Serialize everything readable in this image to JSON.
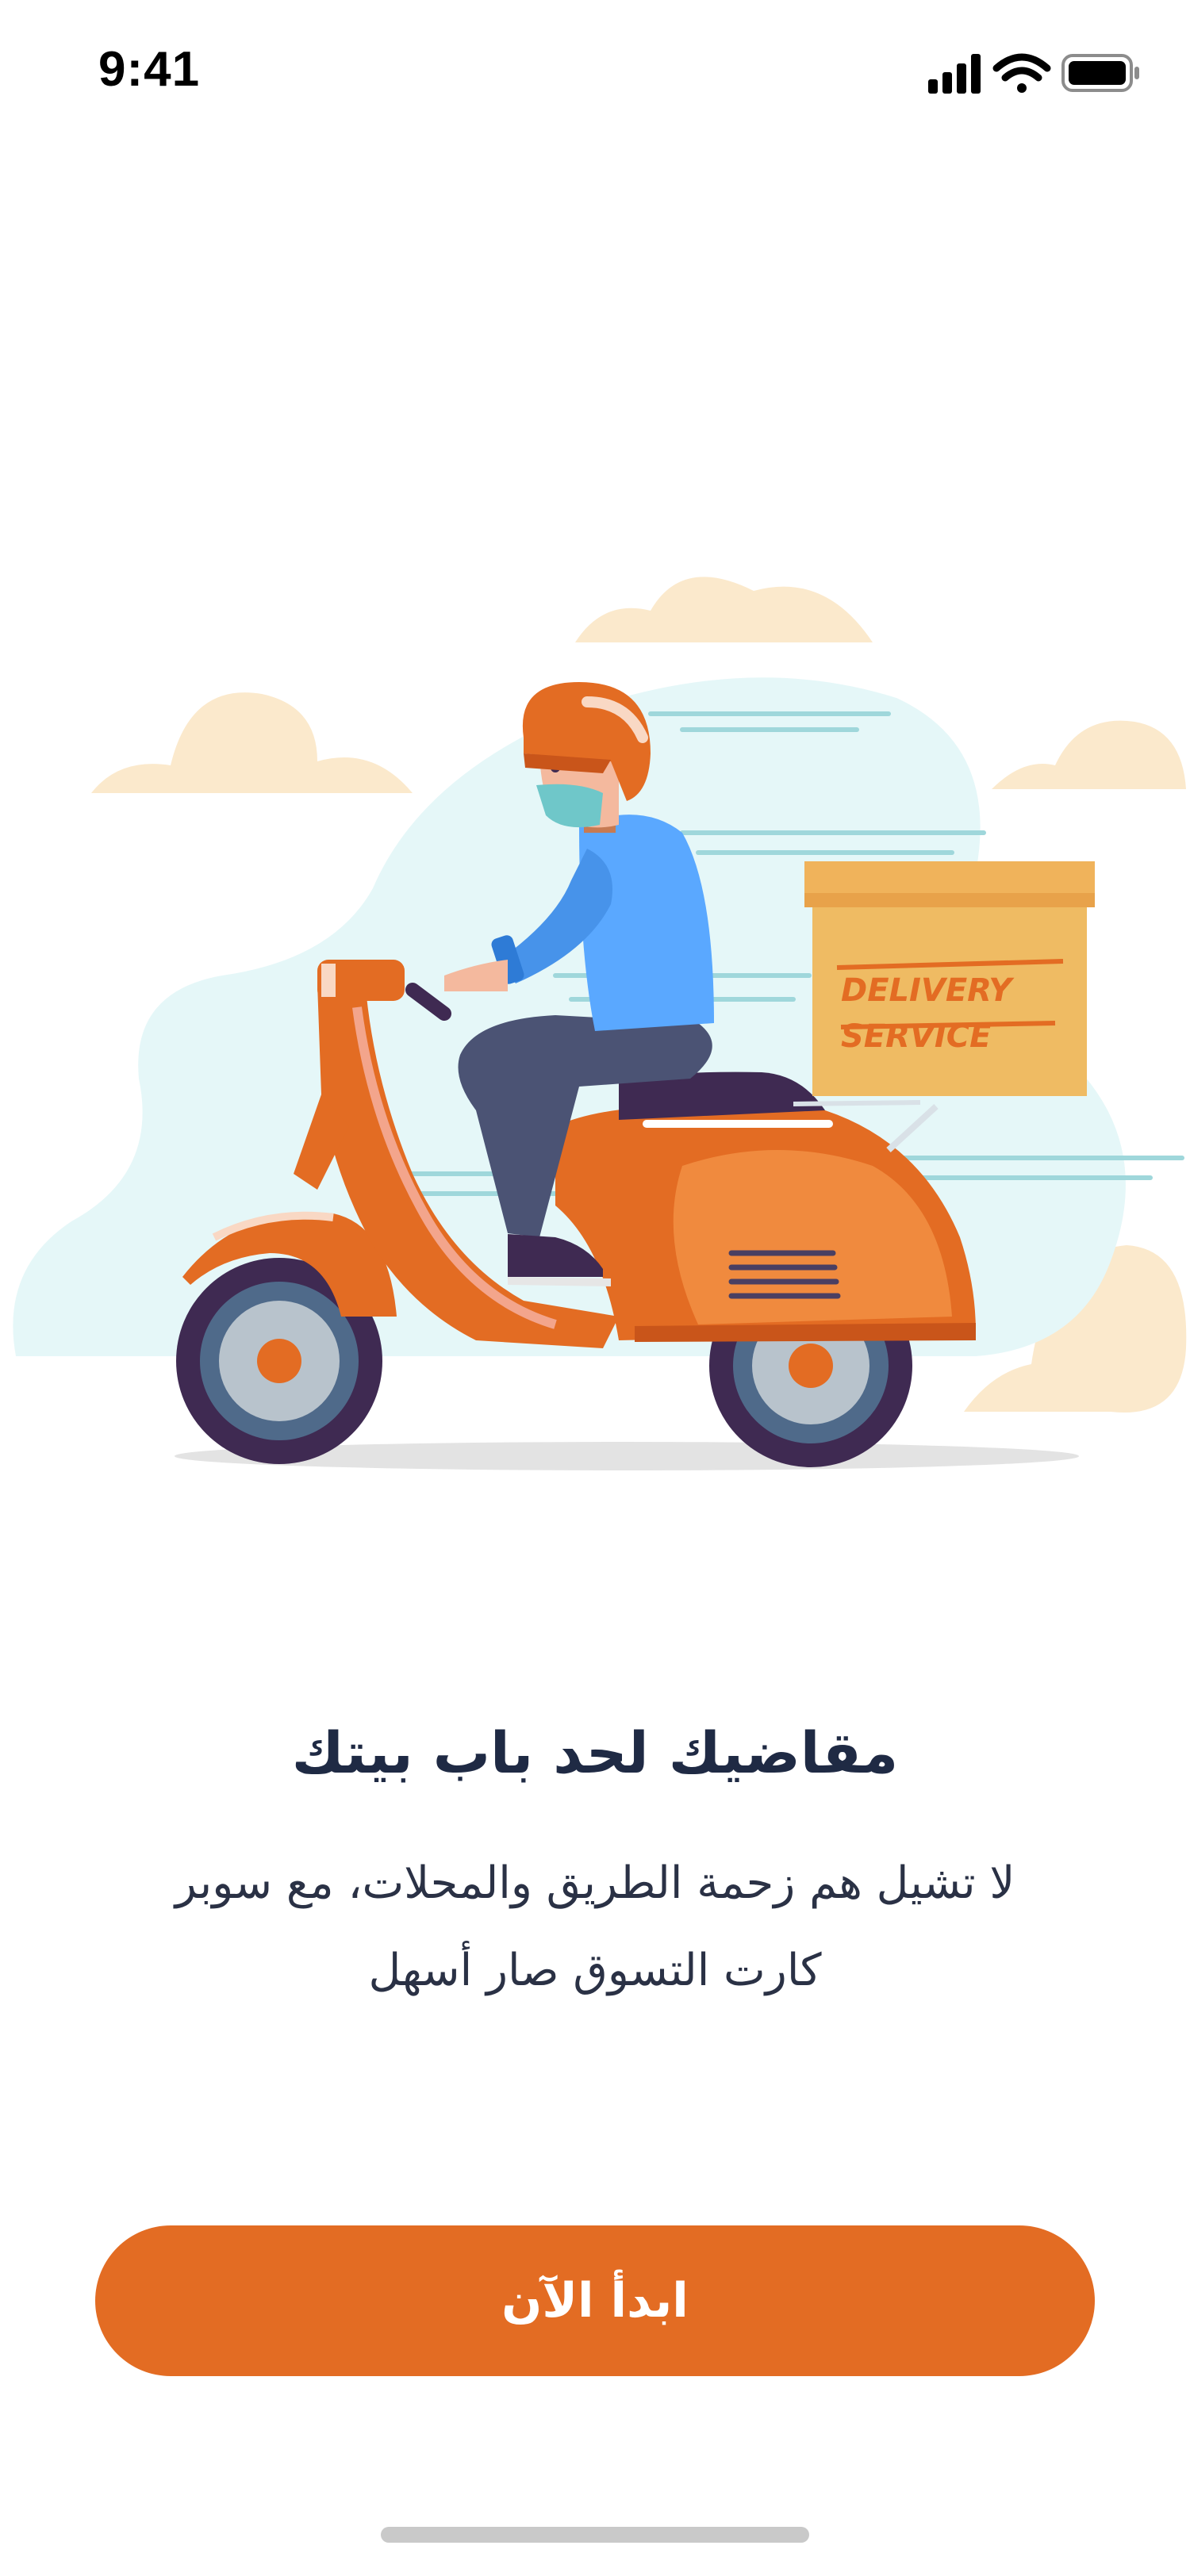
{
  "status_bar": {
    "time": "9:41",
    "icons": [
      "cellular-signal-icon",
      "wifi-icon",
      "battery-icon"
    ]
  },
  "illustration": {
    "box_text_line1": "DELIVERY",
    "box_text_line2": "SERVICE",
    "icon": "delivery-scooter-illustration"
  },
  "content": {
    "title": "مقاضيك لحد باب بيتك",
    "description_line1": "لا تشيل هم زحمة الطريق والمحلات، مع سوبر",
    "description_line2": "كارت التسوق صار أسهل"
  },
  "cta": {
    "label": "ابدأ الآن"
  },
  "colors": {
    "accent": "#e36c23",
    "title": "#1f2a44",
    "text": "#2a3145",
    "cloud": "#fbe9cc",
    "sky": "#e5f7f8",
    "box": "#efbb63",
    "shirt": "#5aa8ff"
  }
}
